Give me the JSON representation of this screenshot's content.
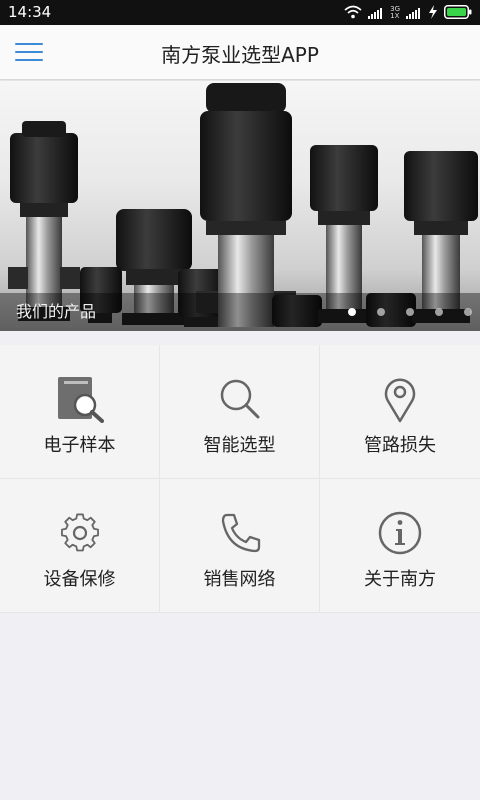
{
  "status_bar": {
    "time": "14:34",
    "network_top": "3G",
    "network_bottom": "1X",
    "icons": [
      "wifi-icon",
      "signal-icon",
      "signal-icon",
      "charging-icon",
      "battery-icon"
    ]
  },
  "header": {
    "title": "南方泵业选型APP",
    "menu_icon": "hamburger-menu-icon",
    "accent_color": "#3b8bd6"
  },
  "banner": {
    "caption": "我们的产品",
    "slide_count": 5,
    "active_slide": 1
  },
  "menu": {
    "items": [
      {
        "label": "电子样本",
        "icon": "catalog-search-icon"
      },
      {
        "label": "智能选型",
        "icon": "search-icon"
      },
      {
        "label": "管路损失",
        "icon": "location-pin-icon"
      },
      {
        "label": "设备保修",
        "icon": "gear-icon"
      },
      {
        "label": "销售网络",
        "icon": "phone-icon"
      },
      {
        "label": "关于南方",
        "icon": "info-icon"
      }
    ]
  }
}
